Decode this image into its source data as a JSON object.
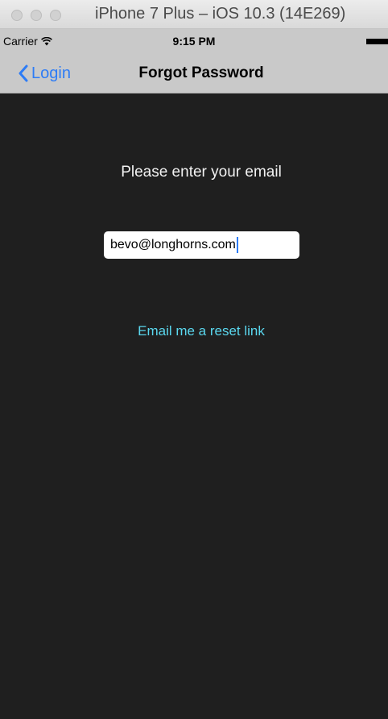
{
  "window": {
    "title": "iPhone 7 Plus – iOS 10.3 (14E269)"
  },
  "status_bar": {
    "carrier": "Carrier",
    "time": "9:15 PM"
  },
  "nav_bar": {
    "back_label": "Login",
    "title": "Forgot Password"
  },
  "main": {
    "prompt": "Please enter your email",
    "email_value": "bevo@longhorns.com",
    "reset_link": "Email me a reset link"
  },
  "colors": {
    "background": "#1f1f1f",
    "nav_background": "#c9c9c9",
    "ios_blue": "#2d7cf6",
    "link_cyan": "#5ad7ee"
  }
}
